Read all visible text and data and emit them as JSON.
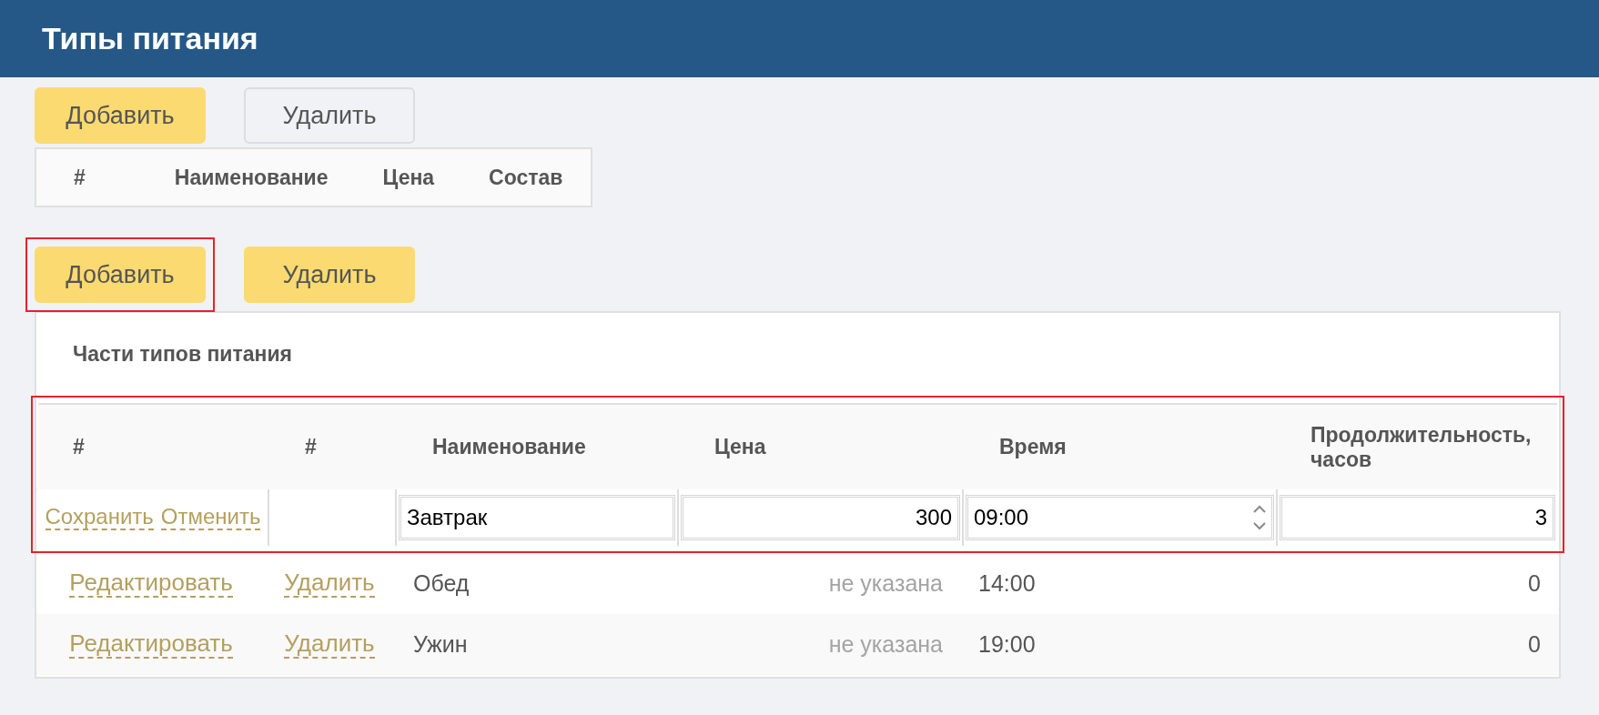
{
  "header": {
    "title": "Типы питания"
  },
  "top_toolbar": {
    "buttons": [
      {
        "label": "Добавить",
        "disabled": false,
        "highlighted": false
      },
      {
        "label": "Удалить",
        "disabled": true,
        "highlighted": false
      }
    ]
  },
  "types_table": {
    "columns": [
      "#",
      "Наименование",
      "Цена",
      "Состав"
    ]
  },
  "parts_toolbar": {
    "buttons": [
      {
        "label": "Добавить",
        "disabled": false,
        "highlighted": true
      },
      {
        "label": "Удалить",
        "disabled": false,
        "highlighted": false
      }
    ]
  },
  "parts_panel": {
    "title": "Части типов питания",
    "table": {
      "highlighted": true,
      "columns": [
        "#",
        "#",
        "Наименование",
        "Цена",
        "Время",
        "Продолжительность, часов"
      ],
      "edit_row": {
        "actions": [
          "Сохранить",
          "Отменить"
        ],
        "name": "Завтрак",
        "price": "300",
        "time": "09:00",
        "duration": "3"
      },
      "rows": [
        {
          "actions": [
            "Редактировать",
            "Удалить"
          ],
          "name": "Обед",
          "price": "не указана",
          "price_missing": true,
          "time": "14:00",
          "duration": "0"
        },
        {
          "actions": [
            "Редактировать",
            "Удалить"
          ],
          "name": "Ужин",
          "price": "не указана",
          "price_missing": true,
          "time": "19:00",
          "duration": "0"
        }
      ]
    }
  }
}
